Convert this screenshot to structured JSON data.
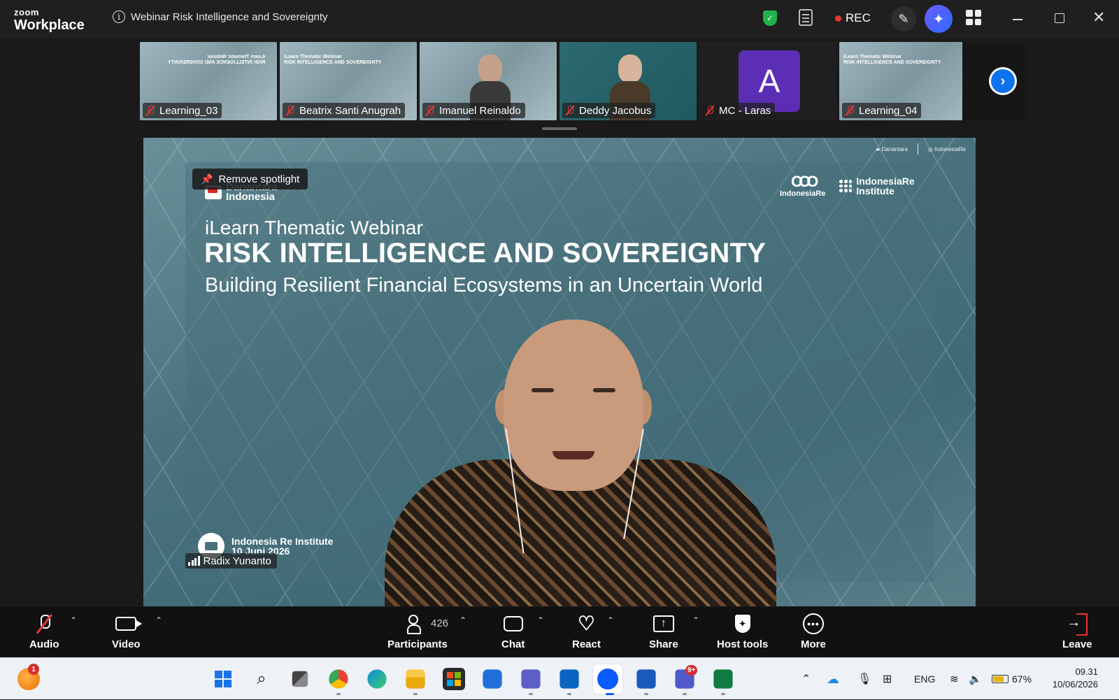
{
  "app": {
    "brand_top": "zoom",
    "brand_bottom": "Workplace",
    "meeting_title": "Webinar Risk Intelligence and Sovereignty",
    "rec_label": "REC",
    "colors": {
      "title_bar": "#1f1f1f",
      "secure_green": "#22b24c",
      "rec_red": "#e53935",
      "accent_blue": "#0e72ed",
      "avatar_purple": "#5b2eb5"
    }
  },
  "participants_strip": [
    {
      "name": "Learning_03",
      "muted": true,
      "kind": "slide-mirrored"
    },
    {
      "name": "Beatrix Santi Anugrah",
      "muted": true,
      "kind": "slide"
    },
    {
      "name": "Imanuel Reinaldo",
      "muted": true,
      "kind": "video"
    },
    {
      "name": "Deddy Jacobus",
      "muted": true,
      "kind": "video-slide"
    },
    {
      "name": "MC - Laras",
      "muted": true,
      "kind": "avatar",
      "avatar_letter": "A"
    },
    {
      "name": "Learning_04",
      "muted": true,
      "kind": "slide"
    }
  ],
  "thumb_slide_text": {
    "line1": "iLearn Thematic Webinar",
    "line2": "RISK INTELLIGENCE AND SOVEREIGNTY",
    "line3": "Building Resilient Financial Ecosystems in an Uncertain World"
  },
  "stage": {
    "spotlight_label": "Remove spotlight",
    "logo_danantara": "Danantara\nIndonesia",
    "logo_indonesiare": "IndonesiaRe",
    "logo_institute": "IndonesiaRe\nInstitute",
    "slide_subtitle": "iLearn Thematic Webinar",
    "slide_title": "RISK INTELLIGENCE AND SOVEREIGNTY",
    "slide_description": "Building Resilient Financial Ecosystems in an Uncertain World",
    "event_org": "Indonesia Re Institute",
    "event_date": "10 Juni 2026",
    "speaker_name": "Radix Yunanto"
  },
  "toolbar": {
    "audio": "Audio",
    "video": "Video",
    "participants": "Participants",
    "participants_count": "426",
    "chat": "Chat",
    "react": "React",
    "share": "Share",
    "host_tools": "Host tools",
    "more": "More",
    "leave": "Leave"
  },
  "taskbar": {
    "notification_count": "1",
    "teams_badge": "9+",
    "language": "ENG",
    "battery": "67%",
    "time": "09.31",
    "date": "10/06/2026"
  }
}
